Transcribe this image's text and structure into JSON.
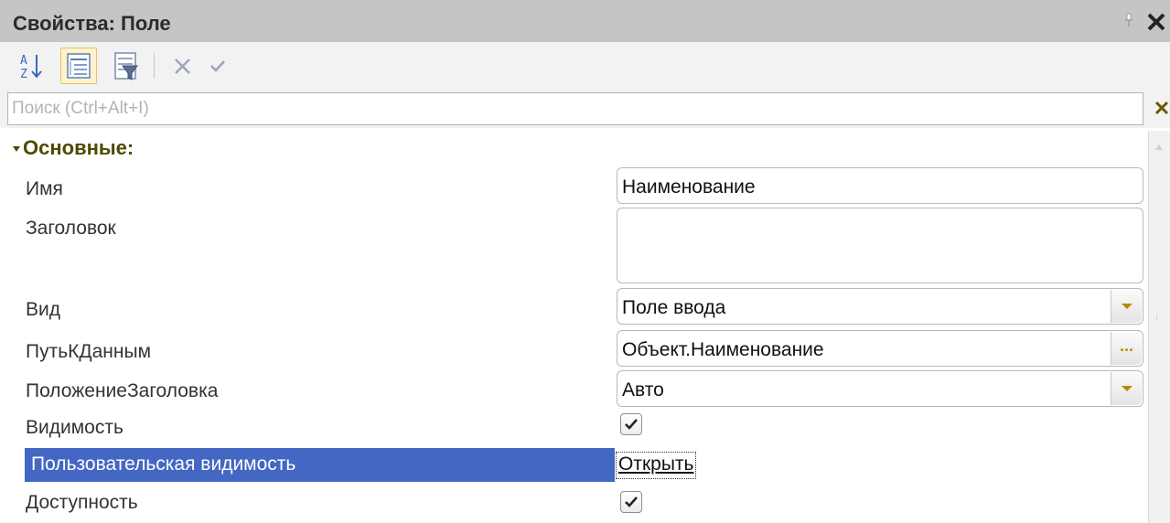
{
  "window": {
    "title": "Свойства: Поле",
    "pin_icon": "pin-icon",
    "close_icon": "close-icon"
  },
  "toolbar": {
    "buttons": [
      {
        "name": "sort-alphabetically",
        "icon": "sort-az-icon"
      },
      {
        "name": "group-by-category",
        "icon": "categories-icon",
        "active": true
      },
      {
        "name": "filter",
        "icon": "filter-icon"
      },
      {
        "name": "cancel",
        "icon": "cross-icon"
      },
      {
        "name": "apply",
        "icon": "check-icon"
      }
    ]
  },
  "search": {
    "placeholder": "Поиск (Ctrl+Alt+I)",
    "value": "",
    "clear_icon": "close-icon"
  },
  "group": {
    "label": "Основные:",
    "expanded": true
  },
  "properties": {
    "name": {
      "label": "Имя",
      "value": "Наименование"
    },
    "title": {
      "label": "Заголовок",
      "value": ""
    },
    "view": {
      "label": "Вид",
      "value": "Поле ввода"
    },
    "data_path": {
      "label": "ПутьКДанным",
      "value": "Объект.Наименование",
      "button": "..."
    },
    "title_position": {
      "label": "ПоложениеЗаголовка",
      "value": "Авто"
    },
    "visibility": {
      "label": "Видимость",
      "checked": true
    },
    "user_visibility": {
      "label": "Пользовательская видимость",
      "link": "Открыть",
      "selected": true
    },
    "enabled": {
      "label": "Доступность",
      "checked": true
    }
  },
  "colors": {
    "title_bar": "#c5c5c5",
    "selection": "#4467c4",
    "group_label": "#4f4a00",
    "accent_button": "#fff3cc"
  }
}
